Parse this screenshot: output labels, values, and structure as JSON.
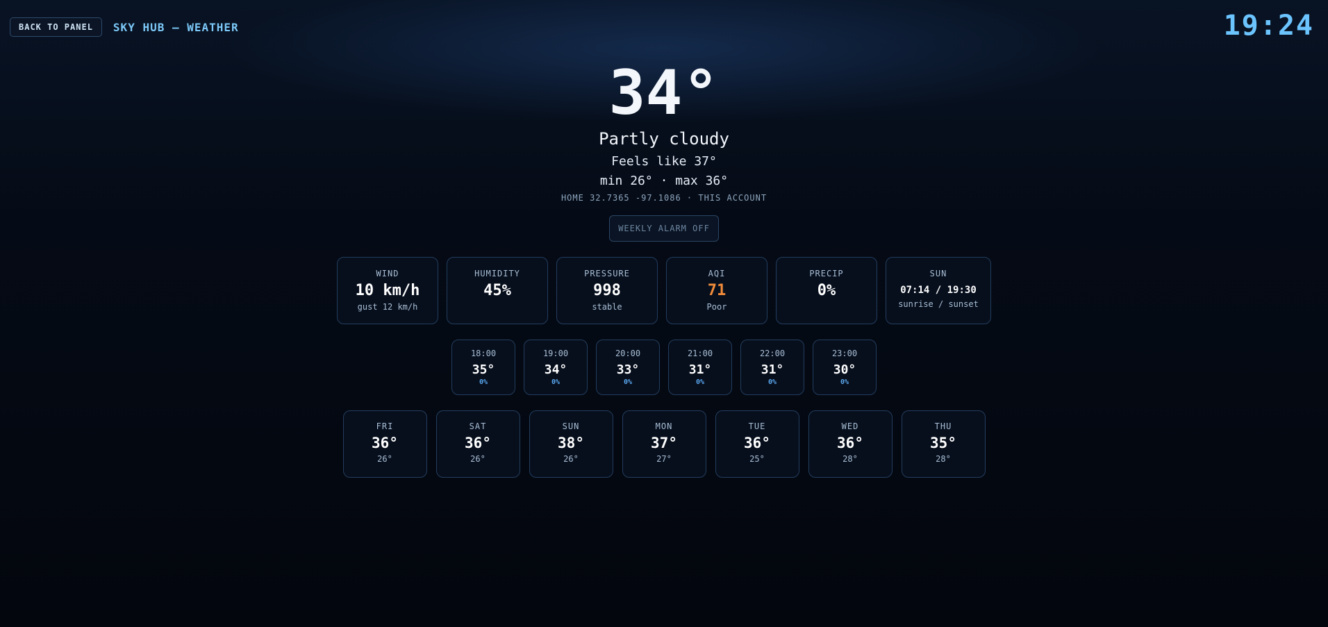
{
  "header": {
    "back_label": "BACK TO PANEL",
    "title": "SKY HUB — WEATHER",
    "clock": "19:24"
  },
  "current": {
    "temp": "34°",
    "condition": "Partly cloudy",
    "feels_like": "Feels like 37°",
    "min_max": "min 26° · max 36°",
    "location": "HOME 32.7365 -97.1086 · THIS ACCOUNT",
    "alarm_label": "WEEKLY ALARM OFF"
  },
  "colors": {
    "accent": "#6cc4ff",
    "aqi_poor": "#f28c3a",
    "precip": "#5aa8f0"
  },
  "stats": [
    {
      "label": "WIND",
      "value": "10 km/h",
      "sub": "gust 12 km/h"
    },
    {
      "label": "HUMIDITY",
      "value": "45%",
      "sub": ""
    },
    {
      "label": "PRESSURE",
      "value": "998",
      "sub": "stable"
    },
    {
      "label": "AQI",
      "value": "71",
      "sub": "Poor"
    },
    {
      "label": "PRECIP",
      "value": "0%",
      "sub": ""
    },
    {
      "label": "SUN",
      "value": "07:14 / 19:30",
      "sub": "sunrise / sunset"
    }
  ],
  "hourly": [
    {
      "time": "18:00",
      "temp": "35°",
      "precip": "0%"
    },
    {
      "time": "19:00",
      "temp": "34°",
      "precip": "0%"
    },
    {
      "time": "20:00",
      "temp": "33°",
      "precip": "0%"
    },
    {
      "time": "21:00",
      "temp": "31°",
      "precip": "0%"
    },
    {
      "time": "22:00",
      "temp": "31°",
      "precip": "0%"
    },
    {
      "time": "23:00",
      "temp": "30°",
      "precip": "0%"
    }
  ],
  "daily": [
    {
      "day": "FRI",
      "hi": "36°",
      "lo": "26°"
    },
    {
      "day": "SAT",
      "hi": "36°",
      "lo": "26°"
    },
    {
      "day": "SUN",
      "hi": "38°",
      "lo": "26°"
    },
    {
      "day": "MON",
      "hi": "37°",
      "lo": "27°"
    },
    {
      "day": "TUE",
      "hi": "36°",
      "lo": "25°"
    },
    {
      "day": "WED",
      "hi": "36°",
      "lo": "28°"
    },
    {
      "day": "THU",
      "hi": "35°",
      "lo": "28°"
    }
  ]
}
